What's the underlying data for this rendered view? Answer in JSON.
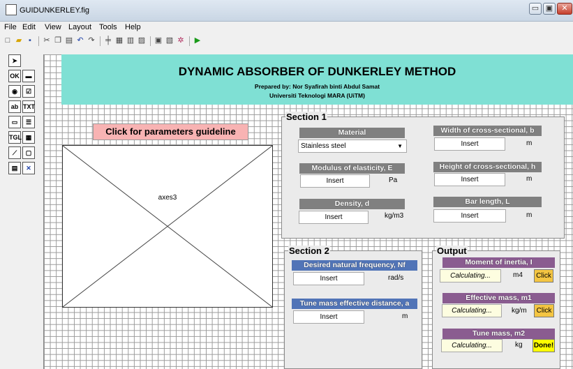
{
  "window": {
    "title": "GUIDUNKERLEY.fig",
    "minimize": "▭",
    "restore": "▣",
    "close": "✕"
  },
  "menu": [
    "File",
    "Edit",
    "View",
    "Layout",
    "Tools",
    "Help"
  ],
  "header": {
    "title": "DYNAMIC ABSORBER OF DUNKERLEY METHOD",
    "author": "Prepared by: Nor Syafirah binti Abdul Samat",
    "university": "Universiti Teknologi MARA (UiTM)"
  },
  "guideline_button": "Click for parameters guideline",
  "axes": {
    "label": "axes3"
  },
  "section1": {
    "title": "Section 1",
    "material_label": "Material",
    "material_value": "Stainless steel",
    "modulus_label": "Modulus of elasticity, E",
    "modulus_value": "Insert",
    "modulus_unit": "Pa",
    "density_label": "Density, d",
    "density_value": "Insert",
    "density_unit": "kg/m3",
    "width_label": "Width of cross-sectional, b",
    "width_value": "Insert",
    "width_unit": "m",
    "height_label": "Height of cross-sectional, h",
    "height_value": "Insert",
    "height_unit": "m",
    "length_label": "Bar length, L",
    "length_value": "Insert",
    "length_unit": "m"
  },
  "section2": {
    "title": "Section 2",
    "freq_label": "Desired natural frequency, Nf",
    "freq_value": "Insert",
    "freq_unit": "rad/s",
    "dist_label": "Tune mass effective distance, a",
    "dist_value": "Insert",
    "dist_unit": "m"
  },
  "output": {
    "title": "Output",
    "inertia_label": "Moment of inertia, I",
    "inertia_value": "Calculating...",
    "inertia_unit": "m4",
    "inertia_button": "Click",
    "mass1_label": "Effective mass, m1",
    "mass1_value": "Calculating...",
    "mass1_unit": "kg/m",
    "mass1_button": "Click",
    "mass2_label": "Tune mass, m2",
    "mass2_value": "Calculating...",
    "mass2_unit": "kg",
    "mass2_button": "Done!"
  },
  "colors": {
    "header": "#7fe0d4",
    "click_button": "#f4c542",
    "done_button": "#ffff00",
    "guideline_button": "#f8b3b3"
  }
}
